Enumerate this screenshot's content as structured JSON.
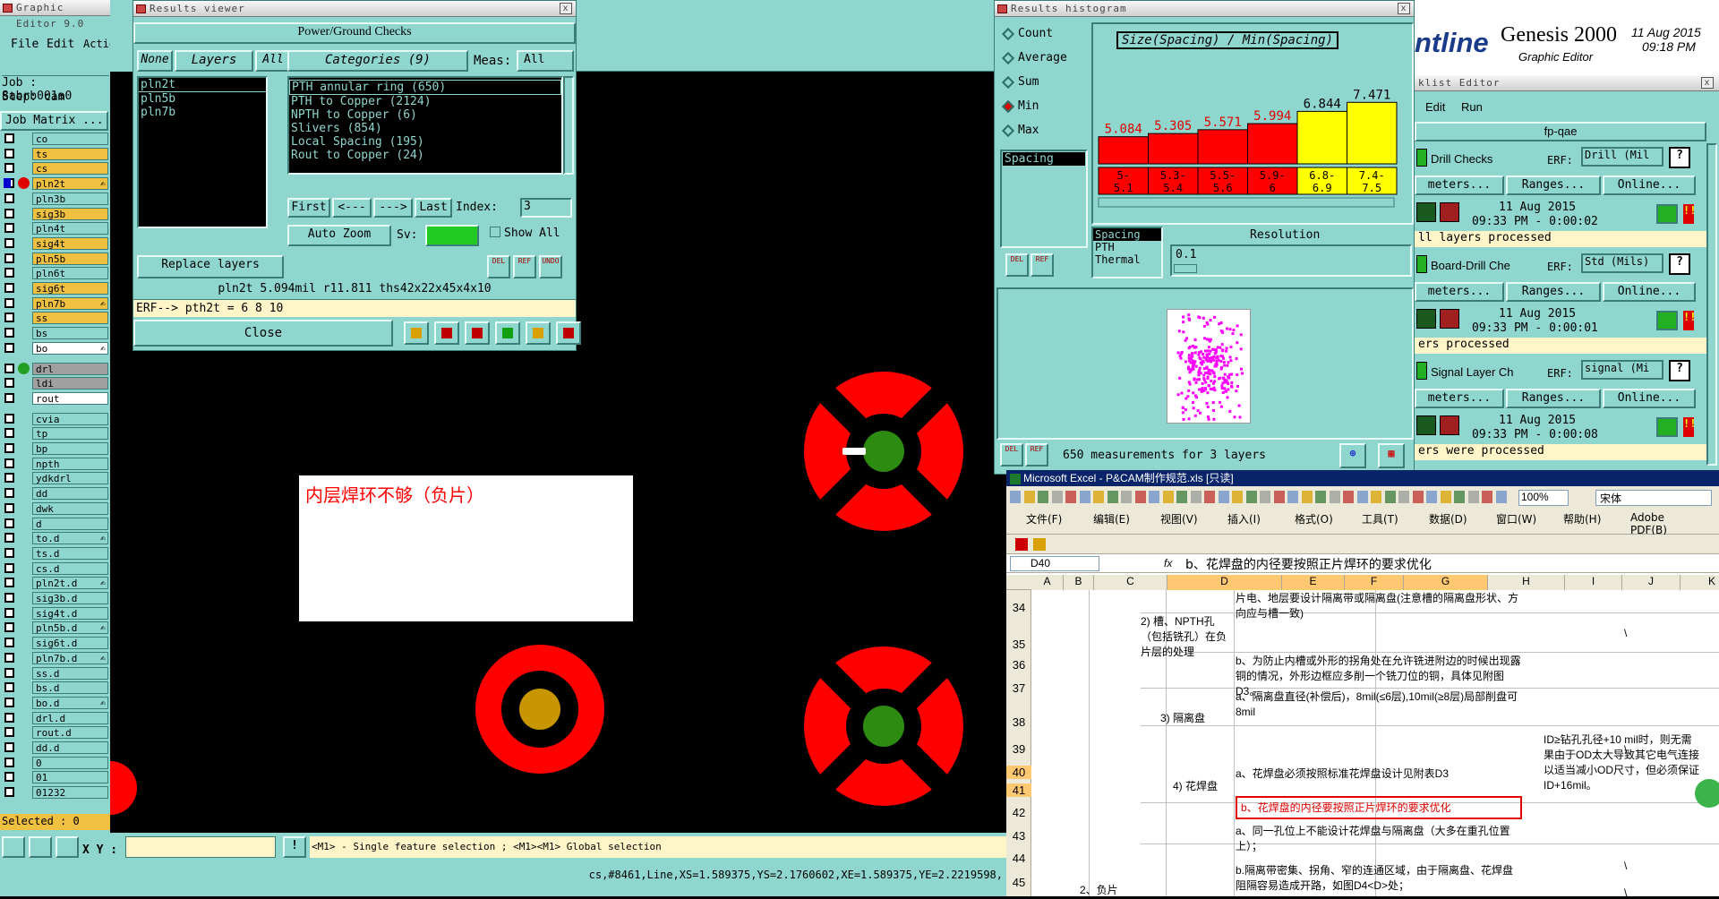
{
  "editor": {
    "title": "Graphic Editor 9.0",
    "menu": [
      "File",
      "Edit",
      "Actions"
    ],
    "job": "Job : 8abrb001a0",
    "step": "Step: cam",
    "matrix": "Job Matrix ...",
    "selected": "Selected : 0",
    "xy": "X Y :",
    "hint": "<M1> - Single feature selection ; <M1><M1> Global selection",
    "status": "cs,#8461,Line,XS=1.589375,YS=2.1760602,XE=1.589375,YE=2.2219598,",
    "layers": [
      {
        "n": "co",
        "c": "g"
      },
      {
        "n": "ts",
        "c": "y"
      },
      {
        "n": "cs",
        "c": "y"
      },
      {
        "n": "pln2t",
        "c": "y"
      },
      {
        "n": "pln3b",
        "c": "g"
      },
      {
        "n": "sig3b",
        "c": "y"
      },
      {
        "n": "pln4t",
        "c": "g"
      },
      {
        "n": "sig4t",
        "c": "y"
      },
      {
        "n": "pln5b",
        "c": "y"
      },
      {
        "n": "pln6t",
        "c": "g"
      },
      {
        "n": "sig6t",
        "c": "y"
      },
      {
        "n": "pln7b",
        "c": "y"
      },
      {
        "n": "ss",
        "c": "y"
      },
      {
        "n": "bs",
        "c": "g"
      },
      {
        "n": "bo",
        "c": "w"
      },
      {
        "n": "drl",
        "c": "gr"
      },
      {
        "n": "ldi",
        "c": "gr"
      },
      {
        "n": "rout",
        "c": "w"
      },
      {
        "n": "cvia",
        "c": "g"
      },
      {
        "n": "tp",
        "c": "g"
      },
      {
        "n": "bp",
        "c": "g"
      },
      {
        "n": "npth",
        "c": "g"
      },
      {
        "n": "ydkdrl",
        "c": "g"
      },
      {
        "n": "dd",
        "c": "g"
      },
      {
        "n": "dwk",
        "c": "g"
      },
      {
        "n": "d",
        "c": "g"
      },
      {
        "n": "to.d",
        "c": "g"
      },
      {
        "n": "ts.d",
        "c": "g"
      },
      {
        "n": "cs.d",
        "c": "g"
      },
      {
        "n": "pln2t.d",
        "c": "g"
      },
      {
        "n": "sig3b.d",
        "c": "g"
      },
      {
        "n": "sig4t.d",
        "c": "g"
      },
      {
        "n": "pln5b.d",
        "c": "g"
      },
      {
        "n": "sig6t.d",
        "c": "g"
      },
      {
        "n": "pln7b.d",
        "c": "g"
      },
      {
        "n": "ss.d",
        "c": "g"
      },
      {
        "n": "bs.d",
        "c": "g"
      },
      {
        "n": "bo.d",
        "c": "g"
      },
      {
        "n": "drl.d",
        "c": "g"
      },
      {
        "n": "rout.d",
        "c": "g"
      },
      {
        "n": "dd.d",
        "c": "g"
      },
      {
        "n": "0",
        "c": "g"
      },
      {
        "n": "01",
        "c": "g"
      },
      {
        "n": "01232",
        "c": "g"
      }
    ]
  },
  "viewer": {
    "title": "Results viewer",
    "header": "Power/Ground Checks",
    "none": "None",
    "layers": "Layers",
    "all": "All",
    "categories": "Categories (9)",
    "meas": "Meas:",
    "meas_val": "All",
    "layer_list": [
      "pln2t",
      "pln5b",
      "pln7b"
    ],
    "cat_list": [
      "PTH annular ring (650)",
      "PTH to Copper (2124)",
      "NPTH to Copper (6)",
      "Slivers (854)",
      "Local Spacing (195)",
      "Rout to Copper (24)"
    ],
    "first": "First",
    "prev": "<---",
    "next": "--->",
    "last": "Last",
    "index": "Index:",
    "index_val": "3",
    "autozoom": "Auto Zoom",
    "sv": "Sv:",
    "showall": "Show All",
    "replace": "Replace layers",
    "info": "pln2t    5.094mil    r11.811    ths42x22x45x4x10",
    "erf": "ERF--> pth2t = 6 8 10",
    "close": "Close"
  },
  "histogram": {
    "title": "Results histogram",
    "options": [
      "Count",
      "Average",
      "Sum",
      "Min",
      "Max"
    ],
    "chart_title": "Size(Spacing) / Min(Spacing)",
    "spacing": "Spacing",
    "list2": [
      "Spacing",
      "PTH",
      "Thermal"
    ],
    "resolution": "Resolution",
    "res_val": "0.1",
    "summary": "650 measurements for 3 layers",
    "chart_data": {
      "type": "bar",
      "title": "Size(Spacing) / Min(Spacing)",
      "categories": [
        "5-5.1",
        "5.3-5.4",
        "5.5-5.6",
        "5.9-6",
        "6.8-6.9",
        "7.4-7.5"
      ],
      "cat_lines": [
        [
          "5-",
          "5.1"
        ],
        [
          "5.3-",
          "5.4"
        ],
        [
          "5.5-",
          "5.6"
        ],
        [
          "5.9-",
          "6"
        ],
        [
          "6.8-",
          "6.9"
        ],
        [
          "7.4-",
          "7.5"
        ]
      ],
      "values": [
        5.084,
        5.305,
        5.571,
        5.994,
        6.844,
        7.471
      ],
      "labels": [
        "5.084",
        "5.305",
        "5.571",
        "5.994",
        "6.844",
        "7.471"
      ],
      "colors": [
        "#ff0000",
        "#ff0000",
        "#ff0000",
        "#ff0000",
        "#ffff00",
        "#ffff00"
      ],
      "ylim": [
        0,
        7.8
      ]
    }
  },
  "genesis": {
    "brand": "ntline",
    "product": "Genesis 2000",
    "sub": "Graphic Editor",
    "date": "11 Aug 2015",
    "time": "09:18 PM",
    "checklist": "klist Editor",
    "menu": [
      "Edit",
      "Run"
    ],
    "name": "fp-qae",
    "checks": [
      {
        "name": "Drill Checks",
        "erf": "ERF:",
        "erf_val": "Drill (Mil",
        "params": "meters...",
        "ranges": "Ranges...",
        "online": "Online...",
        "date": "11 Aug 2015",
        "time": "09:33 PM - 0:00:02",
        "status": "ll layers processed"
      },
      {
        "name": "Board-Drill Che",
        "erf": "ERF:",
        "erf_val": "Std (Mils)",
        "params": "meters...",
        "ranges": "Ranges...",
        "online": "Online...",
        "date": "11 Aug 2015",
        "time": "09:33 PM - 0:00:01",
        "status": "ers processed"
      },
      {
        "name": "Signal Layer Ch",
        "erf": "ERF:",
        "erf_val": "signal (Mi",
        "params": "meters...",
        "ranges": "Ranges...",
        "online": "Online...",
        "date": "11 Aug 2015",
        "time": "09:33 PM - 0:00:08",
        "status": "ers were processed"
      }
    ]
  },
  "annotation": "内层焊环不够（负片）",
  "excel": {
    "title": "Microsoft Excel - P&CAM制作规范.xls  [只读]",
    "menu": [
      "文件(F)",
      "编辑(E)",
      "视图(V)",
      "插入(I)",
      "格式(O)",
      "工具(T)",
      "数据(D)",
      "窗口(W)",
      "帮助(H)",
      "Adobe PDF(B)"
    ],
    "zoom": "100%",
    "font": "宋体",
    "namebox": "D40",
    "fx": "fx",
    "formula": "b、花焊盘的内径要按照正片焊环的要求优化",
    "cols": [
      "A",
      "B",
      "C",
      "D",
      "E",
      "F",
      "G",
      "H",
      "I",
      "J",
      "K"
    ],
    "rows": [
      "34",
      "35",
      "36",
      "37",
      "38",
      "39",
      "40",
      "41",
      "42",
      "43",
      "44",
      "45"
    ],
    "cells": {
      "c34": "2) 槽、NPTH孔（包括铣孔）在负片层的处理",
      "d34a": "片电、地层要设计隔离带或隔离盘(注意槽的隔离盘形状、方向应与槽一致)",
      "d35": "b、为防止内槽或外形的拐角处在允许铣进附边的时候出现露铜的情况，外形边框应多削一个铣刀位的铜，具体见附图D3。",
      "c37": "3) 隔离盘",
      "d37": "a、隔离盘直径(补偿后)，8mil(≤6层),10mil(≥8层)局部削盘可8mil",
      "c39": "4) 花焊盘",
      "d38": "a、花焊盘必须按照标准花焊盘设计见附表D3",
      "d40": "b、花焊盘的内径要按照正片焊环的要求优化",
      "i38": "ID≥钻孔孔径+10 mil时，则无需",
      "i38b": "果由于OD太大导致其它电气连接",
      "i38c": "以适当减小OD尺寸，但必须保证",
      "i38d": "ID+16mil。",
      "d42": "a、同一孔位上不能设计花焊盘与隔离盘（大多在重孔位置上）；",
      "d44": "b.隔离带密集、拐角、窄的连通区域，由于隔离盘、花焊盘阻隔容易造成开路，如图D4<D>处；",
      "b45": "2、负片",
      "j": "\\"
    }
  }
}
